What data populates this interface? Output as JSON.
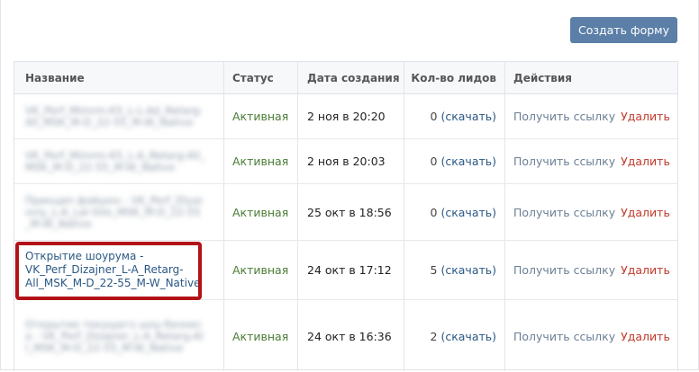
{
  "toolbar": {
    "create_label": "Создать форму"
  },
  "columns": {
    "name": "Название",
    "status": "Статус",
    "date": "Дата создания",
    "leads": "Кол-во лидов",
    "actions": "Действия"
  },
  "rows": [
    {
      "name": "VK_Perf_Mimrm-K5_L-L-Ad_Retarg-All_MSK_M-D_22-55_M-W_Native",
      "status": "Активная",
      "date": "2 ноя в 20:20",
      "leads_count": "0",
      "leads_link": "(скачать)",
      "action_get": "Получить ссылку",
      "action_delete": "Удалить"
    },
    {
      "name": "VK_Perf_Mimrm-K5_L-A_Retarg-All_MSK_M-D_22-55_M-W_Native",
      "status": "Активная",
      "date": "2 ноя в 20:03",
      "leads_count": "0",
      "leads_link": "(скачать)",
      "action_get": "Получить ссылку",
      "action_delete": "Удалить"
    },
    {
      "name": "Принцип фэйшон - VK_Perf_Dlyaroviy_L-A_Lal-Site_MSK_M-D_22-55_M-W_Native",
      "status": "Активная",
      "date": "25 окт в 18:56",
      "leads_count": "0",
      "leads_link": "(скачать)",
      "action_get": "Получить ссылку",
      "action_delete": "Удалить"
    },
    {
      "name": "Открытие шоурума - VK_Perf_Dizajner_L-A_Retarg-All_MSK_M-D_22-55_M-W_Native",
      "status": "Активная",
      "date": "24 окт в 17:12",
      "leads_count": "5",
      "leads_link": "(скачать)",
      "action_get": "Получить ссылку",
      "action_delete": "Удалить"
    },
    {
      "name": "Открытие текущего шоу-бизнеса - VK_Perf_Dizajner_L-A_Retarg-All_MSK_M-D_22-55_M-W_Native",
      "status": "Активная",
      "date": "24 окт в 16:36",
      "leads_count": "2",
      "leads_link": "(скачать)",
      "action_get": "Получить ссылку",
      "action_delete": "Удалить"
    }
  ],
  "colors": {
    "accent": "#5b7fa7",
    "status": "#4a7c35",
    "delete": "#c0392b",
    "highlight": "#b31217"
  }
}
